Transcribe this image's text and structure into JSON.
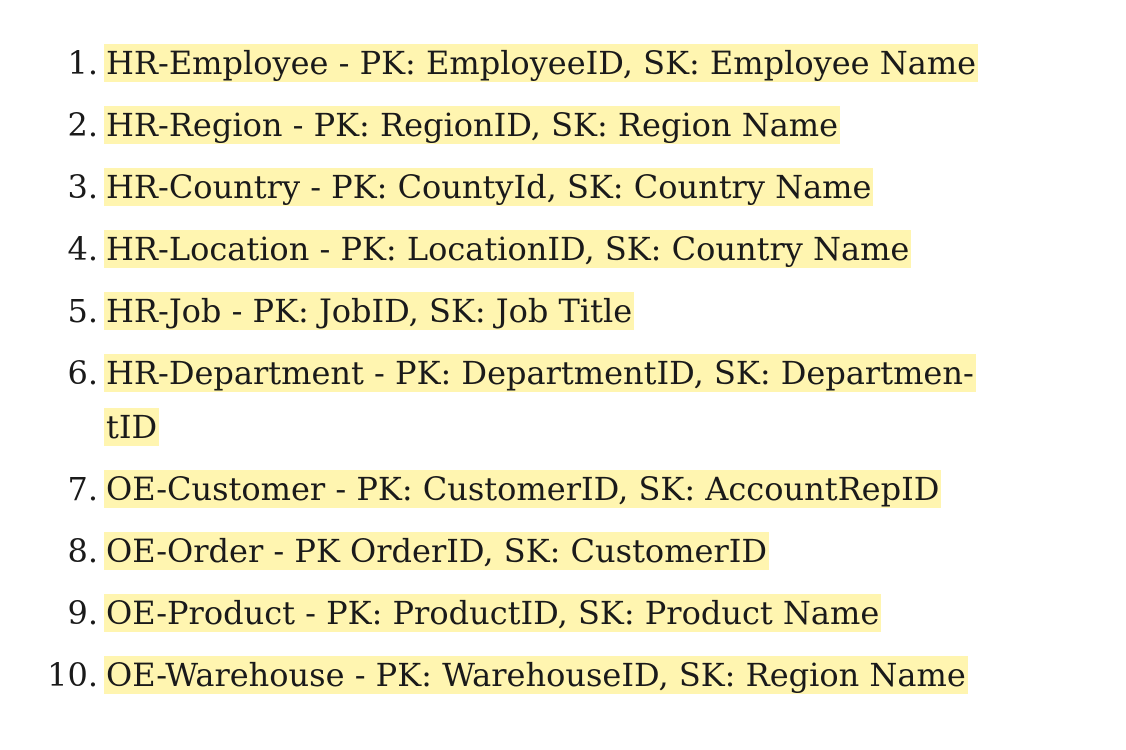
{
  "list": {
    "items": [
      {
        "number": "1.",
        "text": "HR-Employee - PK: EmployeeID, SK: Employee Name"
      },
      {
        "number": "2.",
        "text": "HR-Region - PK: RegionID, SK: Region Name"
      },
      {
        "number": "3.",
        "text": "HR-Country - PK: CountyId, SK: Country Name"
      },
      {
        "number": "4.",
        "text": "HR-Location - PK: LocationID, SK: Country Name"
      },
      {
        "number": "5.",
        "text": "HR-Job - PK: JobID, SK: Job Title"
      },
      {
        "number": "6.",
        "text_line1": "HR-Department - PK: DepartmentID, SK: Departmen-",
        "text_line2": "tID"
      },
      {
        "number": "7.",
        "text": "OE-Customer - PK: CustomerID, SK: AccountRepID"
      },
      {
        "number": "8.",
        "text": "OE-Order - PK OrderID, SK: CustomerID"
      },
      {
        "number": "9.",
        "text": "OE-Product - PK: ProductID, SK: Product Name"
      },
      {
        "number": "10.",
        "text": "OE-Warehouse - PK: WarehouseID, SK: Region Name"
      }
    ]
  },
  "colors": {
    "highlight": "#fff5b0",
    "text": "#1a1a1a"
  }
}
